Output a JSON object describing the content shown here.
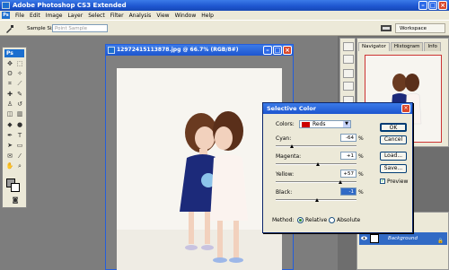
{
  "app": {
    "title": "Adobe Photoshop CS3 Extended",
    "logo": "Ps"
  },
  "menu": [
    "File",
    "Edit",
    "Image",
    "Layer",
    "Select",
    "Filter",
    "Analysis",
    "View",
    "Window",
    "Help"
  ],
  "options": {
    "sample_size_label": "Sample Size:",
    "sample_size_value": "Point Sample",
    "workspace": "Workspace"
  },
  "document": {
    "title": "12972415113878.jpg @ 66.7% (RGB/8#)"
  },
  "navigator": {
    "tabs": [
      "Navigator",
      "Histogram",
      "Info"
    ]
  },
  "layers": {
    "name": "Background"
  },
  "dialog": {
    "title": "Selective Color",
    "colors_label": "Colors:",
    "colors_value": "Reds",
    "sliders": [
      {
        "label": "Cyan:",
        "value": "-64",
        "unit": "%"
      },
      {
        "label": "Magenta:",
        "value": "+1",
        "unit": "%"
      },
      {
        "label": "Yellow:",
        "value": "+57",
        "unit": "%"
      },
      {
        "label": "Black:",
        "value": "-1",
        "unit": "%"
      }
    ],
    "buttons": {
      "ok": "OK",
      "cancel": "Cancel",
      "load": "Load...",
      "save": "Save..."
    },
    "preview_label": "Preview",
    "method_label": "Method:",
    "relative_label": "Relative",
    "absolute_label": "Absolute"
  },
  "colors": {
    "accent": "#1d55cf",
    "swatch": "#cc0000"
  }
}
